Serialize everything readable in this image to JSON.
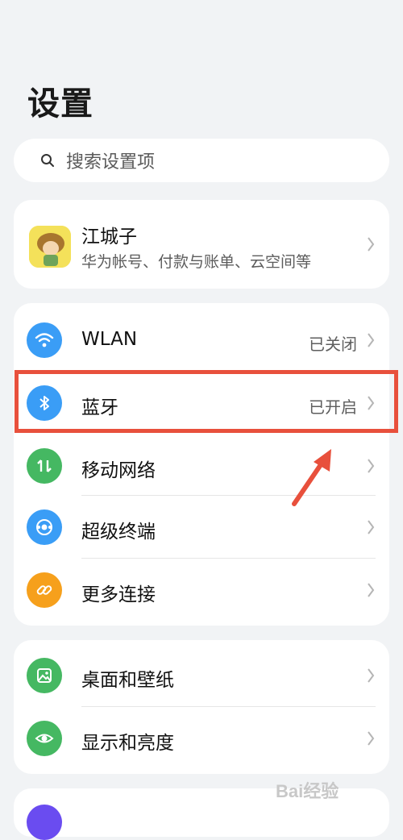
{
  "page": {
    "title": "设置"
  },
  "search": {
    "placeholder": "搜索设置项"
  },
  "account": {
    "name": "江城子",
    "subtitle": "华为帐号、付款与账单、云空间等"
  },
  "connectivity": {
    "items": [
      {
        "label": "WLAN",
        "value": "已关闭",
        "icon": "wifi-icon",
        "color": "#3a9df6"
      },
      {
        "label": "蓝牙",
        "value": "已开启",
        "icon": "bluetooth-icon",
        "color": "#3a9df6"
      },
      {
        "label": "移动网络",
        "value": "",
        "icon": "mobile-data-icon",
        "color": "#45b862"
      },
      {
        "label": "超级终端",
        "value": "",
        "icon": "super-device-icon",
        "color": "#3a9df6"
      },
      {
        "label": "更多连接",
        "value": "",
        "icon": "link-icon",
        "color": "#f6a01c"
      }
    ]
  },
  "display": {
    "items": [
      {
        "label": "桌面和壁纸",
        "icon": "wallpaper-icon",
        "color": "#45b862"
      },
      {
        "label": "显示和亮度",
        "icon": "eye-icon",
        "color": "#45b862"
      }
    ]
  },
  "annotation": {
    "highlight_color": "#e8503c"
  },
  "watermark": {
    "text": "Bai经验"
  }
}
